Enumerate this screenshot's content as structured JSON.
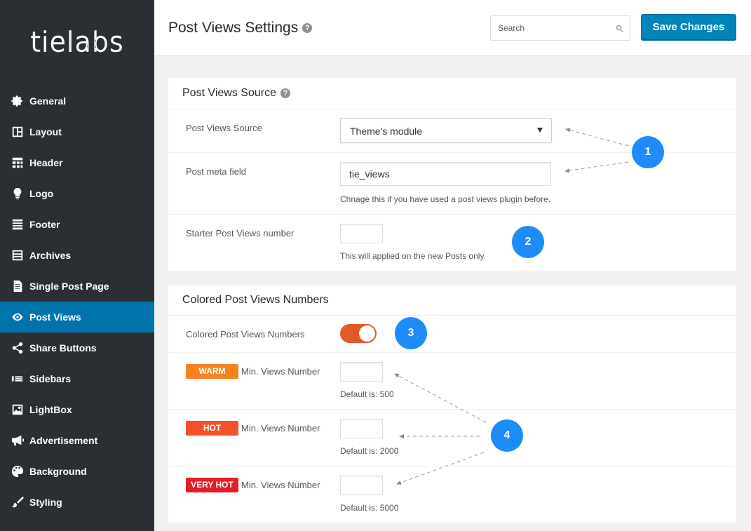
{
  "brand": {
    "logo_text": "tielabs"
  },
  "sidebar": {
    "items": [
      {
        "label": "General",
        "icon": "gear-icon"
      },
      {
        "label": "Layout",
        "icon": "layout-icon"
      },
      {
        "label": "Header",
        "icon": "header-icon"
      },
      {
        "label": "Logo",
        "icon": "lightbulb-icon"
      },
      {
        "label": "Footer",
        "icon": "footer-icon"
      },
      {
        "label": "Archives",
        "icon": "archives-icon"
      },
      {
        "label": "Single Post Page",
        "icon": "document-icon"
      },
      {
        "label": "Post Views",
        "icon": "eye-icon",
        "active": true
      },
      {
        "label": "Share Buttons",
        "icon": "share-icon"
      },
      {
        "label": "Sidebars",
        "icon": "sidebars-icon"
      },
      {
        "label": "LightBox",
        "icon": "image-icon"
      },
      {
        "label": "Advertisement",
        "icon": "megaphone-icon"
      },
      {
        "label": "Background",
        "icon": "palette-icon"
      },
      {
        "label": "Styling",
        "icon": "brush-icon"
      }
    ]
  },
  "header": {
    "title": "Post Views Settings",
    "search_placeholder": "Search",
    "save_label": "Save Changes"
  },
  "source_panel": {
    "title": "Post Views Source",
    "source_label": "Post Views Source",
    "source_value": "Theme's module",
    "meta_label": "Post meta field",
    "meta_value": "tie_views",
    "meta_hint": "Chnage this if you have used a post views plugin before.",
    "starter_label": "Starter Post Views number",
    "starter_hint": "This will applied on the new Posts only."
  },
  "colored_panel": {
    "title": "Colored Post Views Numbers",
    "toggle_label": "Colored Post Views Numbers",
    "toggle_on": true,
    "levels": [
      {
        "badge": "WARM",
        "label": "Min. Views Number",
        "hint": "Default is: 500",
        "color": "#f6821f"
      },
      {
        "badge": "HOT",
        "label": "Min. Views Number",
        "hint": "Default is: 2000",
        "color": "#f4502d"
      },
      {
        "badge": "VERY HOT",
        "label": "Min. Views Number",
        "hint": "Default is: 5000",
        "color": "#e41e26"
      }
    ]
  },
  "callouts": [
    "1",
    "2",
    "3",
    "4"
  ],
  "colors": {
    "accent": "#0073aa",
    "sidebar_bg": "#2b2f33",
    "callout": "#1e8cf8",
    "toggle": "#e2592a"
  }
}
